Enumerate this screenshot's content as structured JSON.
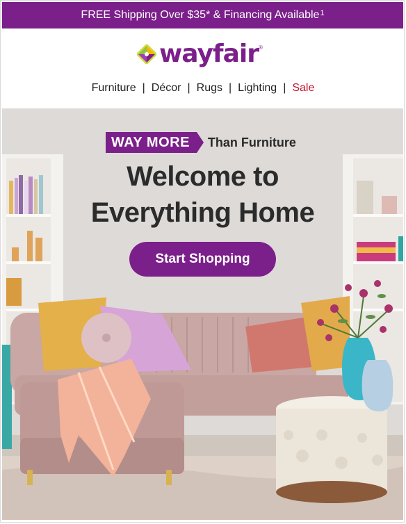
{
  "promo": {
    "text": "FREE Shipping Over $35* & Financing Available",
    "footnote": "1"
  },
  "brand": {
    "name": "wayfair",
    "tm": "®",
    "color": "#7b1f8a",
    "logo_icon": "wayfair-pinwheel-icon"
  },
  "nav": {
    "items": [
      {
        "label": "Furniture"
      },
      {
        "label": "Décor"
      },
      {
        "label": "Rugs"
      },
      {
        "label": "Lighting"
      },
      {
        "label": "Sale"
      }
    ],
    "separator": "|",
    "sale_color": "#c8102e"
  },
  "hero": {
    "tag_label": "WAY MORE",
    "tag_suffix": "Than Furniture",
    "headline_line1": "Welcome to",
    "headline_line2": "Everything Home",
    "cta_label": "Start Shopping",
    "image_description_icon": "living-room-sofa-scene"
  }
}
